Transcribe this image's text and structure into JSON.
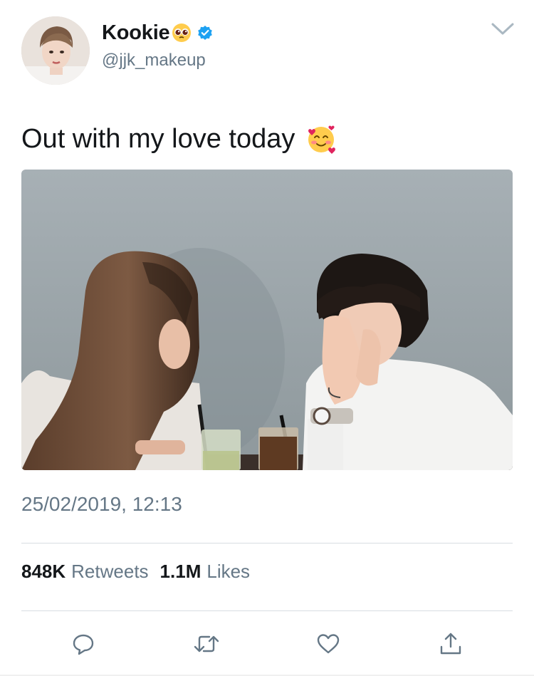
{
  "tweet": {
    "display_name": "Kookie",
    "handle": "@jjk_makeup",
    "text": "Out with my love today",
    "timestamp": "25/02/2019, 12:13"
  },
  "stats": {
    "retweets_count": "848K",
    "retweets_label": "Retweets",
    "likes_count": "1.1M",
    "likes_label": "Likes"
  },
  "icons": {
    "name_emoji": "pleading-face",
    "verified": "verified-badge",
    "text_emoji": "smiling-face-with-hearts",
    "menu": "chevron-down-icon",
    "actions": [
      "reply-icon",
      "retweet-icon",
      "like-icon",
      "share-icon"
    ]
  },
  "colors": {
    "text_primary": "#14171a",
    "text_secondary": "#657786",
    "verified_blue": "#1da1f2",
    "icon_gray": "#657786"
  }
}
